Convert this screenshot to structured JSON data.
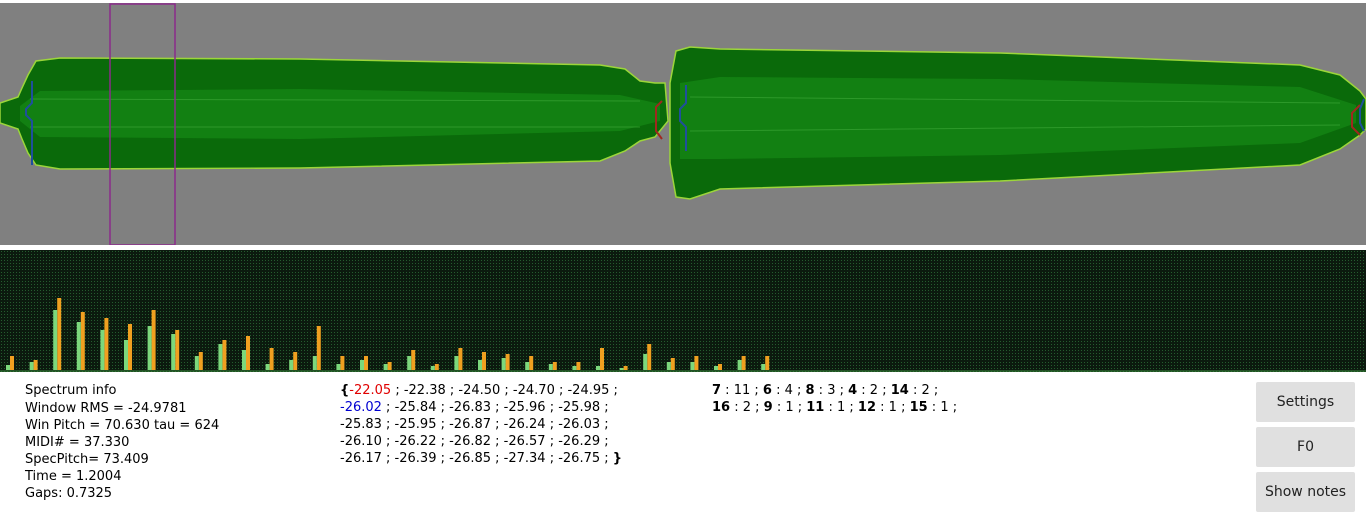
{
  "colors": {
    "wave_background": "#808080",
    "wave_dark_green": "#0a6a0a",
    "wave_mid_green": "#128012",
    "wave_outline": "#9cd63a",
    "selection_border": "#8b2a8b",
    "marker_blue": "#1f4f9c",
    "marker_red": "#a0281e",
    "spectrum_background": "#0b1a0e",
    "bar_orange": "#f0a020",
    "bar_green": "#7cd87c",
    "button_background": "#e0e0e0"
  },
  "spectrum_info": {
    "title": "Spectrum info",
    "window_rms": "Window RMS = -24.9781",
    "win_pitch": "Win Pitch = 70.630 tau = 624",
    "midi": "MIDI# = 37.330",
    "spec_pitch": "SpecPitch= 73.409",
    "time": "Time = 1.2004",
    "gaps": "Gaps: 0.7325"
  },
  "levels": {
    "open_brace": "{",
    "close_brace": "}",
    "first_value": "-22.05",
    "row1_rest": " ; -22.38 ; -24.50 ; -24.70 ; -24.95 ;",
    "row2_first": "-26.02",
    "row2_rest": " ; -25.84 ; -26.83 ; -25.96 ; -25.98 ;",
    "row3": "-25.83 ; -25.95 ; -26.87 ; -26.24 ; -26.03 ;",
    "row4": "-26.10 ; -26.22 ; -26.82 ; -26.57 ; -26.29 ;",
    "row5": "-26.17 ; -26.39 ; -26.85 ; -27.34 ; -26.75 ; "
  },
  "harmonic_counts": {
    "row1": [
      {
        "k": "7",
        "v": " : 11 ; "
      },
      {
        "k": "6",
        "v": " : 4 ; "
      },
      {
        "k": "8",
        "v": " : 3 ; "
      },
      {
        "k": "4",
        "v": " : 2 ; "
      },
      {
        "k": "14",
        "v": " : 2 ;"
      }
    ],
    "row2": [
      {
        "k": "16",
        "v": " : 2 ; "
      },
      {
        "k": "9",
        "v": " : 1 ; "
      },
      {
        "k": "11",
        "v": " : 1 ; "
      },
      {
        "k": "12",
        "v": " : 1 ; "
      },
      {
        "k": "15",
        "v": " : 1 ;"
      }
    ]
  },
  "buttons": {
    "settings": "Settings",
    "f0": "F0",
    "show_notes": "Show notes"
  },
  "spectrum_bars": [
    {
      "orange": 14,
      "green": 5
    },
    {
      "orange": 10,
      "green": 8
    },
    {
      "orange": 72,
      "green": 60
    },
    {
      "orange": 58,
      "green": 48
    },
    {
      "orange": 52,
      "green": 40
    },
    {
      "orange": 46,
      "green": 30
    },
    {
      "orange": 60,
      "green": 44
    },
    {
      "orange": 40,
      "green": 36
    },
    {
      "orange": 18,
      "green": 14
    },
    {
      "orange": 30,
      "green": 26
    },
    {
      "orange": 34,
      "green": 20
    },
    {
      "orange": 22,
      "green": 6
    },
    {
      "orange": 18,
      "green": 10
    },
    {
      "orange": 44,
      "green": 14
    },
    {
      "orange": 14,
      "green": 6
    },
    {
      "orange": 14,
      "green": 10
    },
    {
      "orange": 8,
      "green": 6
    },
    {
      "orange": 20,
      "green": 14
    },
    {
      "orange": 6,
      "green": 4
    },
    {
      "orange": 22,
      "green": 14
    },
    {
      "orange": 18,
      "green": 10
    },
    {
      "orange": 16,
      "green": 12
    },
    {
      "orange": 14,
      "green": 8
    },
    {
      "orange": 8,
      "green": 6
    },
    {
      "orange": 8,
      "green": 4
    },
    {
      "orange": 22,
      "green": 4
    },
    {
      "orange": 4,
      "green": 2
    },
    {
      "orange": 26,
      "green": 16
    },
    {
      "orange": 12,
      "green": 8
    },
    {
      "orange": 14,
      "green": 8
    },
    {
      "orange": 6,
      "green": 4
    },
    {
      "orange": 14,
      "green": 10
    },
    {
      "orange": 14,
      "green": 6
    }
  ]
}
